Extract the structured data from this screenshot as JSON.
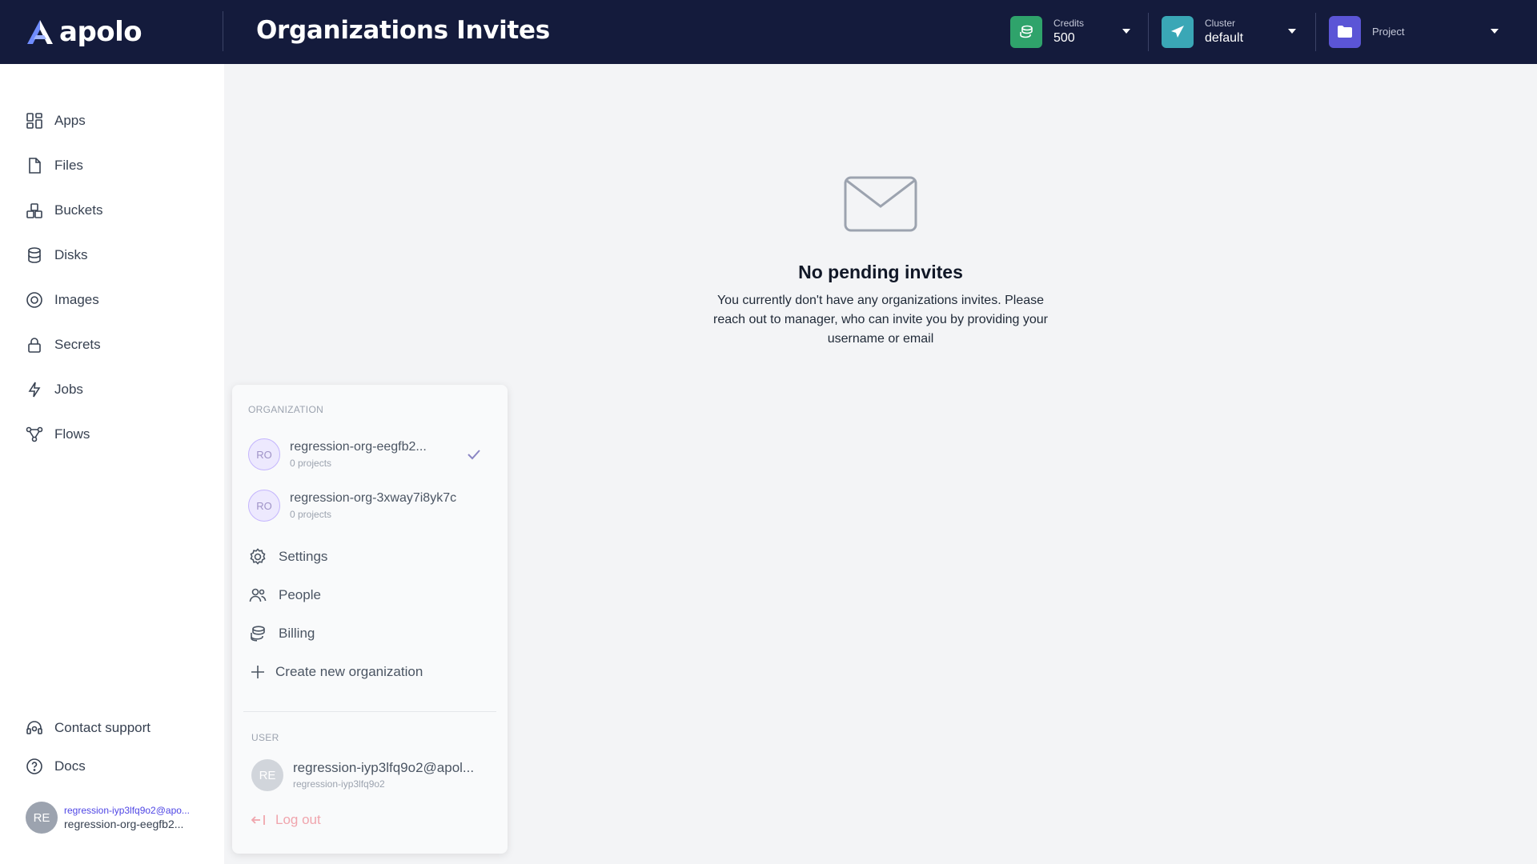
{
  "header": {
    "logo_text": "apolo",
    "title": "Organizations Invites",
    "credits": {
      "label": "Credits",
      "value": "500",
      "color": "#2fa36b"
    },
    "cluster": {
      "label": "Cluster",
      "value": "default",
      "color": "#3aa7b6"
    },
    "project": {
      "label": "Project",
      "color": "#5b55d6"
    }
  },
  "sidebar": {
    "items": [
      {
        "label": "Apps",
        "icon": "apps-icon"
      },
      {
        "label": "Files",
        "icon": "file-icon"
      },
      {
        "label": "Buckets",
        "icon": "buckets-icon"
      },
      {
        "label": "Disks",
        "icon": "database-icon"
      },
      {
        "label": "Images",
        "icon": "image-icon"
      },
      {
        "label": "Secrets",
        "icon": "lock-icon"
      },
      {
        "label": "Jobs",
        "icon": "bolt-icon"
      },
      {
        "label": "Flows",
        "icon": "flows-icon"
      }
    ],
    "footer": [
      {
        "label": "Contact support",
        "icon": "headset-icon"
      },
      {
        "label": "Docs",
        "icon": "help-icon"
      }
    ],
    "user": {
      "initials": "RE",
      "email": "regression-iyp3lfq9o2@apo...",
      "org": "regression-org-eegfb2..."
    }
  },
  "empty_state": {
    "title": "No pending invites",
    "description": "You currently don't have any organizations invites. Please reach out to manager, who can invite you by providing your username or email"
  },
  "org_menu": {
    "section_label": "ORGANIZATION",
    "orgs": [
      {
        "initials": "RO",
        "name": "regression-org-eegfb2...",
        "sub": "0 projects",
        "selected": true
      },
      {
        "initials": "RO",
        "name": "regression-org-3xway7i8yk7c",
        "sub": "0 projects",
        "selected": false
      }
    ],
    "actions": [
      {
        "label": "Settings",
        "icon": "gear-icon"
      },
      {
        "label": "People",
        "icon": "people-icon"
      },
      {
        "label": "Billing",
        "icon": "billing-icon"
      },
      {
        "label": "Create new organization",
        "icon": "plus-icon"
      }
    ],
    "user_section_label": "USER",
    "user": {
      "initials": "RE",
      "name": "regression-iyp3lfq9o2@apol...",
      "sub": "regression-iyp3lfq9o2"
    },
    "logout_label": "Log out"
  }
}
